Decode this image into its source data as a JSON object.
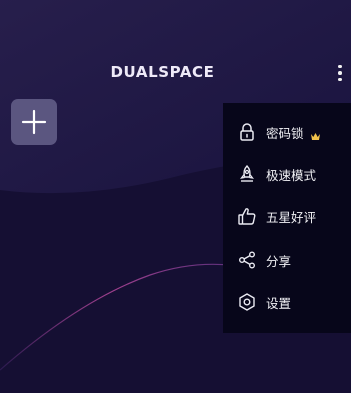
{
  "app": {
    "logo_text": "DUALSPACE"
  },
  "menu": {
    "items": [
      {
        "label": "密码锁",
        "icon": "lock-icon",
        "premium_badge": "crown-icon"
      },
      {
        "label": "极速模式",
        "icon": "rocket-icon"
      },
      {
        "label": "五星好评",
        "icon": "thumbs-up-icon"
      },
      {
        "label": "分享",
        "icon": "share-icon"
      },
      {
        "label": "设置",
        "icon": "settings-icon"
      }
    ]
  },
  "colors": {
    "background": "#150f33",
    "menu_background": "#07061a",
    "accent_curve": "#9c3b8a",
    "crown": "#f0c14b",
    "add_button": "#5b5680"
  },
  "icons": {
    "more": "more-vertical-icon",
    "add": "plus-icon"
  }
}
